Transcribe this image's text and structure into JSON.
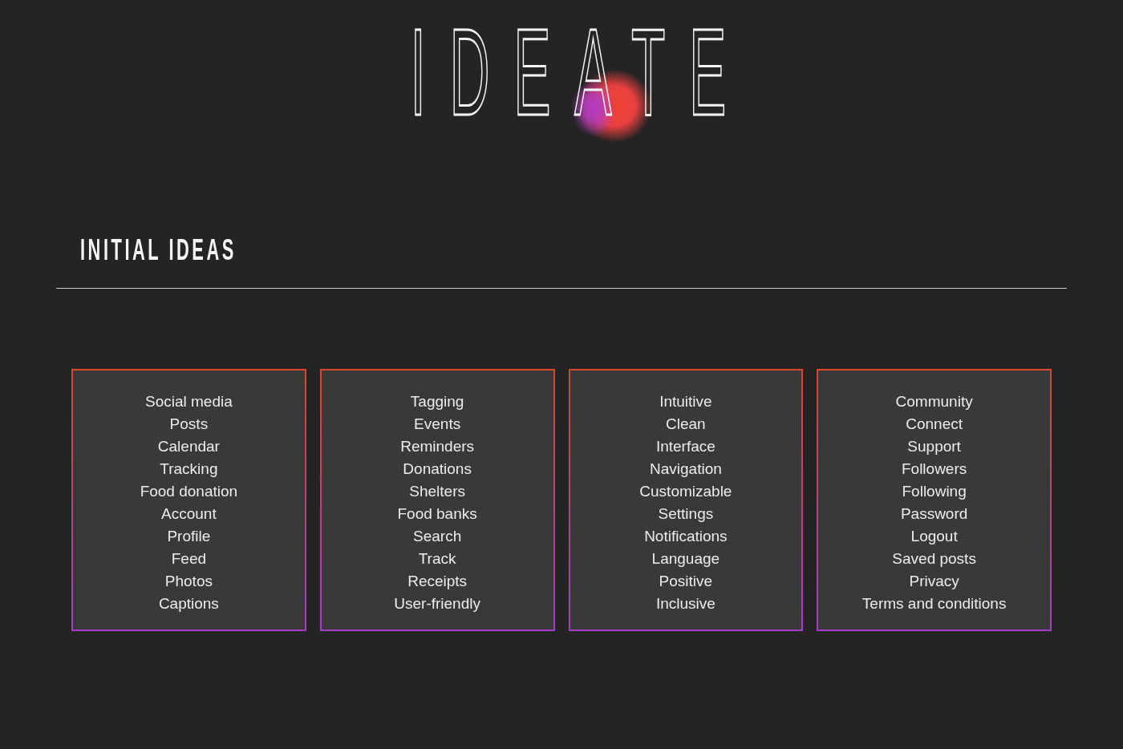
{
  "title": "IDEATE",
  "section": {
    "heading": "INITIAL IDEAS"
  },
  "cards": [
    {
      "items": [
        "Social media",
        "Posts",
        "Calendar",
        "Tracking",
        "Food donation",
        "Account",
        "Profile",
        "Feed",
        "Photos",
        "Captions"
      ]
    },
    {
      "items": [
        "Tagging",
        "Events",
        "Reminders",
        "Donations",
        "Shelters",
        "Food banks",
        "Search",
        "Track",
        "Receipts",
        "User-friendly"
      ]
    },
    {
      "items": [
        "Intuitive",
        "Clean",
        "Interface",
        "Navigation",
        "Customizable",
        "Settings",
        "Notifications",
        "Language",
        "Positive",
        "Inclusive"
      ]
    },
    {
      "items": [
        "Community",
        "Connect",
        "Support",
        "Followers",
        "Following",
        "Password",
        "Logout",
        "Saved posts",
        "Privacy",
        "Terms and conditions"
      ]
    }
  ]
}
